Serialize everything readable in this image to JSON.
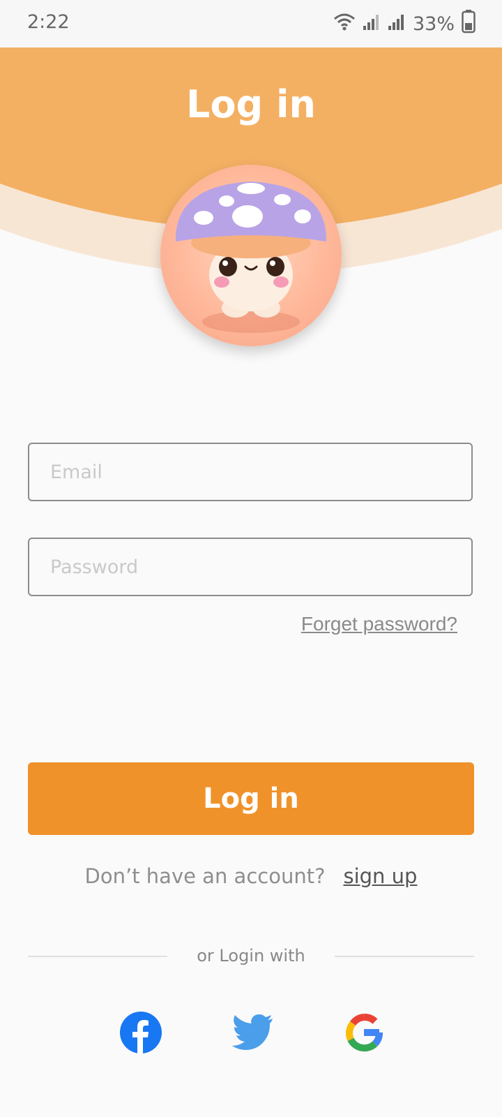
{
  "status_bar": {
    "time": "2:22",
    "battery": "33%"
  },
  "header": {
    "title": "Log in"
  },
  "avatar": {
    "description": "mushroom-character-icon"
  },
  "form": {
    "email_placeholder": "Email",
    "password_placeholder": "Password",
    "forgot_label": "Forget password?"
  },
  "actions": {
    "login_label": "Log in",
    "signup_prompt": "Don’t have an account?",
    "signup_label": "sign up"
  },
  "social": {
    "divider_label": "or Login with",
    "providers": [
      "facebook-icon",
      "twitter-icon",
      "google-icon"
    ]
  },
  "colors": {
    "primary": "#f0922a",
    "header": "#f3b063",
    "header_band": "#f8e6d5"
  }
}
